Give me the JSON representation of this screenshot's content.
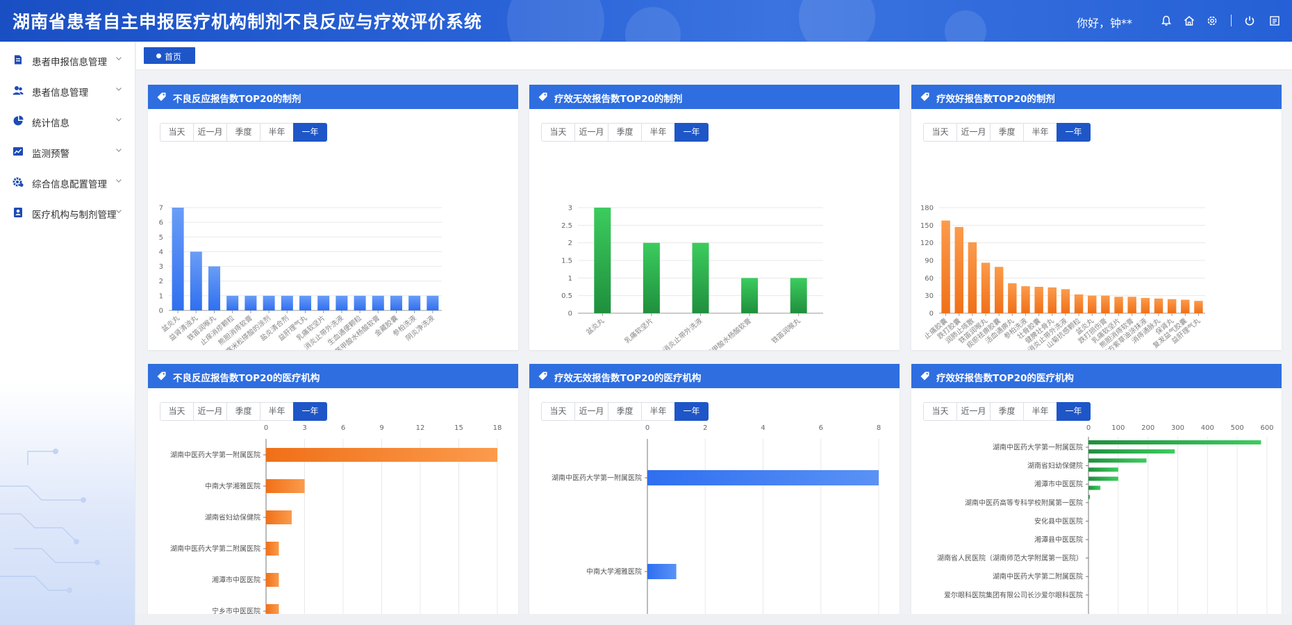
{
  "app": {
    "title": "湖南省患者自主申报医疗机构制剂不良反应与疗效评价系统",
    "greeting": "你好，钟**"
  },
  "header_icons": [
    "bell-icon",
    "home-icon",
    "gear-icon",
    "power-icon",
    "menu-icon"
  ],
  "sidebar": {
    "items": [
      {
        "label": "患者申报信息管理",
        "icon": "report-doc-icon"
      },
      {
        "label": "患者信息管理",
        "icon": "users-icon"
      },
      {
        "label": "统计信息",
        "icon": "pie-chart-icon"
      },
      {
        "label": "监测预警",
        "icon": "trend-chart-icon"
      },
      {
        "label": "综合信息配置管理",
        "icon": "settings-icon"
      },
      {
        "label": "医疗机构与制剂管理",
        "icon": "id-card-icon"
      }
    ]
  },
  "tabs": {
    "home_label": "首页"
  },
  "range_options": [
    "当天",
    "近一月",
    "季度",
    "半年",
    "一年"
  ],
  "active_range": "一年",
  "colors": {
    "header": "#2256cc",
    "panel_head": "#2e6ee0",
    "blue_bar": "#3d7cf0",
    "green_bar": "#2aa34a",
    "orange_bar": "#f37b20"
  },
  "panels": [
    {
      "title": "不良反应报告数TOP20的制剂"
    },
    {
      "title": "疗效无效报告数TOP20的制剂"
    },
    {
      "title": "疗效好报告数TOP20的制剂"
    },
    {
      "title": "不良反应报告数TOP20的医疗机构"
    },
    {
      "title": "疗效无效报告数TOP20的医疗机构"
    },
    {
      "title": "疗效好报告数TOP20的医疗机构"
    }
  ],
  "chart_data": [
    {
      "type": "bar",
      "orientation": "vertical",
      "color": "blue",
      "categories": [
        "盆炎丸",
        "益肾清浊丸",
        "铁笛润喉丸",
        "止痒消疹颗粒",
        "熊胆消痔软膏",
        "地塞米松搽酸的涂剂",
        "盐炎清合剂",
        "益肝理气丸",
        "乳痛软坚片",
        "消炎止带外洗液",
        "生血通便颗粒",
        "苯甲酸水杨酸软膏",
        "金藏胶囊",
        "参柏洗液",
        "阴炎净洗液"
      ],
      "values": [
        7,
        4,
        3,
        1,
        1,
        1,
        1,
        1,
        1,
        1,
        1,
        1,
        1,
        1,
        1
      ],
      "ylim": [
        0,
        7
      ],
      "yticks": [
        0,
        1,
        2,
        3,
        4,
        5,
        6,
        7
      ]
    },
    {
      "type": "bar",
      "orientation": "vertical",
      "color": "green",
      "categories": [
        "盆炎丸",
        "乳痛软坚片",
        "消炎止带外洗液",
        "苯甲酸水杨酸软膏",
        "铁笛润喉丸"
      ],
      "values": [
        3,
        2,
        2,
        1,
        1
      ],
      "ylim": [
        0,
        3
      ],
      "yticks": [
        "0",
        "0.5",
        "1",
        "1.5",
        "2",
        "2.5",
        "3"
      ]
    },
    {
      "type": "bar",
      "orientation": "vertical",
      "color": "orange",
      "categories": [
        "止痛胶囊",
        "跌打胶囊",
        "润肺止咳散",
        "铁笛润喉丸",
        "痰瘀祛痹胶囊",
        "活血通痹丸",
        "参柏洗液",
        "壮骨胶囊",
        "健脾壮骨丸",
        "消炎止带外洗液",
        "山菊抗感颗粒",
        "盆炎丸",
        "跌打损伤膏",
        "乳痛软坚片",
        "熊胆消痔软膏",
        "复方紫草油涂抹液",
        "消痔通脉丸",
        "保肾丸",
        "复发益气胶囊",
        "益肝理气丸"
      ],
      "values": [
        158,
        147,
        121,
        86,
        79,
        51,
        46,
        45,
        44,
        41,
        32,
        30,
        30,
        28,
        28,
        26,
        25,
        24,
        23,
        21
      ],
      "ylim": [
        0,
        180
      ],
      "yticks": [
        0,
        30,
        60,
        90,
        120,
        150,
        180
      ]
    },
    {
      "type": "bar",
      "orientation": "horizontal",
      "color": "orange",
      "categories": [
        "湖南中医药大学第一附属医院",
        "中南大学湘雅医院",
        "湖南省妇幼保健院",
        "湖南中医药大学第二附属医院",
        "湘潭市中医医院",
        "宁乡市中医医院"
      ],
      "values": [
        18,
        3,
        2,
        1,
        1,
        1
      ],
      "xlim": [
        0,
        18
      ],
      "xticks": [
        0,
        3,
        6,
        9,
        12,
        15,
        18
      ]
    },
    {
      "type": "bar",
      "orientation": "horizontal",
      "color": "blue",
      "categories": [
        "湖南中医药大学第一附属医院",
        "中南大学湘雅医院"
      ],
      "values": [
        8,
        1
      ],
      "xlim": [
        0,
        8
      ],
      "xticks": [
        0,
        2,
        4,
        6,
        8
      ]
    },
    {
      "type": "bar",
      "orientation": "horizontal",
      "color": "green",
      "categories": [
        "湖南中医药大学第一附属医院",
        "湖南省妇幼保健院",
        "湘潭市中医医院",
        "湖南中医药高等专科学校附属第一医院",
        "安化县中医医院",
        "湘潭县中医医院",
        "湖南省人民医院（湖南师范大学附属第一医院）",
        "湖南中医药大学第二附属医院",
        "爱尔眼科医院集团有限公司长沙爱尔眼科医院"
      ],
      "values": [
        580,
        290,
        195,
        100,
        100,
        40,
        5
      ],
      "xlim": [
        0,
        600
      ],
      "xticks": [
        0,
        100,
        200,
        300,
        400,
        500,
        600
      ]
    }
  ]
}
